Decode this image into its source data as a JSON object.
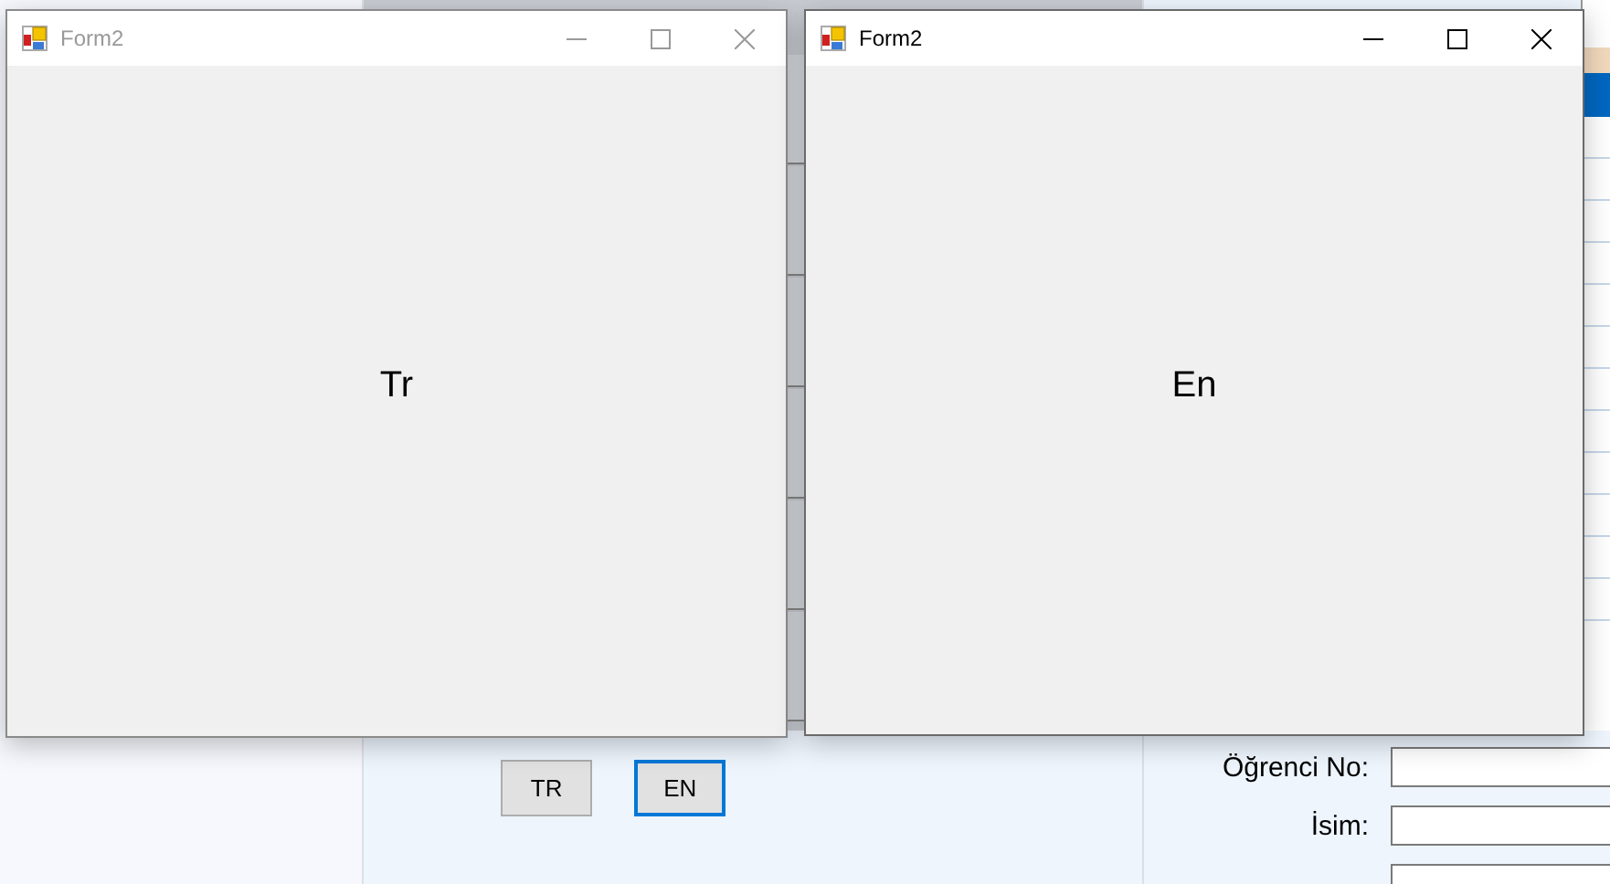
{
  "windows": [
    {
      "title": "Form2",
      "active": false,
      "label": "Tr"
    },
    {
      "title": "Form2",
      "active": true,
      "label": "En"
    }
  ],
  "buttons": [
    {
      "label": "TR",
      "focused": false
    },
    {
      "label": "EN",
      "focused": true
    }
  ],
  "fields": [
    {
      "kind": "labeled",
      "label": "Öğrenci No:"
    },
    {
      "kind": "labeled",
      "label": "İsim:"
    },
    {
      "kind": "unlabeled"
    }
  ]
}
